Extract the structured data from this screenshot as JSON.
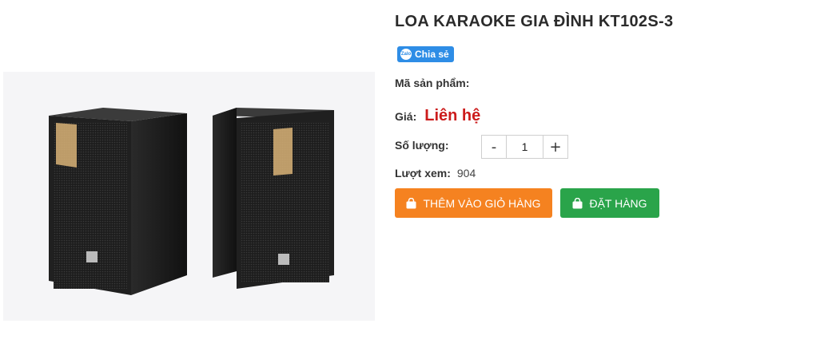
{
  "product": {
    "title": "LOA KARAOKE GIA ĐÌNH KT102S-3",
    "image_alt": "Loa karaoke KT102S-3"
  },
  "share": {
    "logo_text": "Zalo",
    "label": "Chia sẻ"
  },
  "details": {
    "sku_label": "Mã sản phẩm:",
    "sku_value": "",
    "price_label": "Giá:",
    "price_value": "Liên hệ",
    "qty_label": "Số lượng:",
    "qty_minus": "-",
    "qty_value": "1",
    "qty_plus": "+",
    "views_label": "Lượt xem:",
    "views_value": "904"
  },
  "buttons": {
    "add_to_cart": "THÊM VÀO GIỎ HÀNG",
    "order": "ĐẶT HÀNG"
  },
  "colors": {
    "price": "#cc1b1b",
    "add_to_cart_bg": "#f58220",
    "order_bg": "#2aa44a",
    "zalo_bg": "#2e8de6"
  }
}
